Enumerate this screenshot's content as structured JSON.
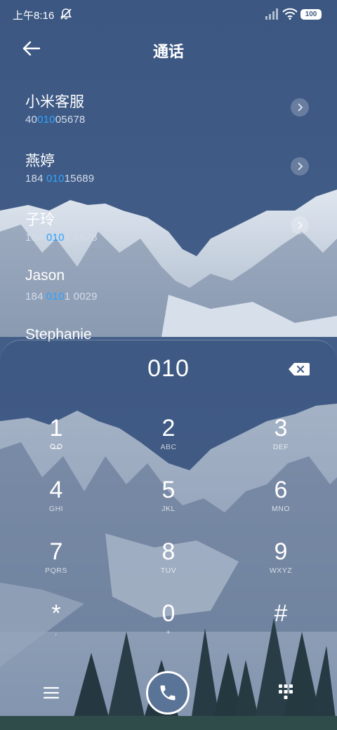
{
  "status_bar": {
    "time": "上午8:16",
    "battery": "100",
    "icons": [
      "do-not-disturb-icon",
      "signal-icon",
      "wifi-icon",
      "battery-icon"
    ]
  },
  "header": {
    "title": "通话",
    "back_icon": "arrow-left-icon"
  },
  "contacts": [
    {
      "name": "小米客服",
      "number_pre": "40",
      "number_match": "010",
      "number_post": "05678"
    },
    {
      "name": "燕婷",
      "number_pre": "184 ",
      "number_match": "010",
      "number_post": "15689"
    },
    {
      "name": "子玲",
      "number_pre": "184 ",
      "number_match": "010",
      "number_post": "1 5678"
    },
    {
      "name": "Jason",
      "number_pre": "184 ",
      "number_match": "010",
      "number_post": "1 0029"
    },
    {
      "name": "Stephanie",
      "number_pre": "",
      "number_match": "",
      "number_post": ""
    }
  ],
  "dialer": {
    "entered_number": "010",
    "keys": [
      {
        "digit": "1",
        "letters": ""
      },
      {
        "digit": "2",
        "letters": "ABC"
      },
      {
        "digit": "3",
        "letters": "DEF"
      },
      {
        "digit": "4",
        "letters": "GHI"
      },
      {
        "digit": "5",
        "letters": "JKL"
      },
      {
        "digit": "6",
        "letters": "MNO"
      },
      {
        "digit": "7",
        "letters": "PQRS"
      },
      {
        "digit": "8",
        "letters": "TUV"
      },
      {
        "digit": "9",
        "letters": "WXYZ"
      },
      {
        "digit": "*",
        "letters": ","
      },
      {
        "digit": "0",
        "letters": "+"
      },
      {
        "digit": "#",
        "letters": ""
      }
    ]
  },
  "colors": {
    "background": "#3f5a82",
    "highlight": "#2fa3ff",
    "call_button": "#5a7497"
  }
}
